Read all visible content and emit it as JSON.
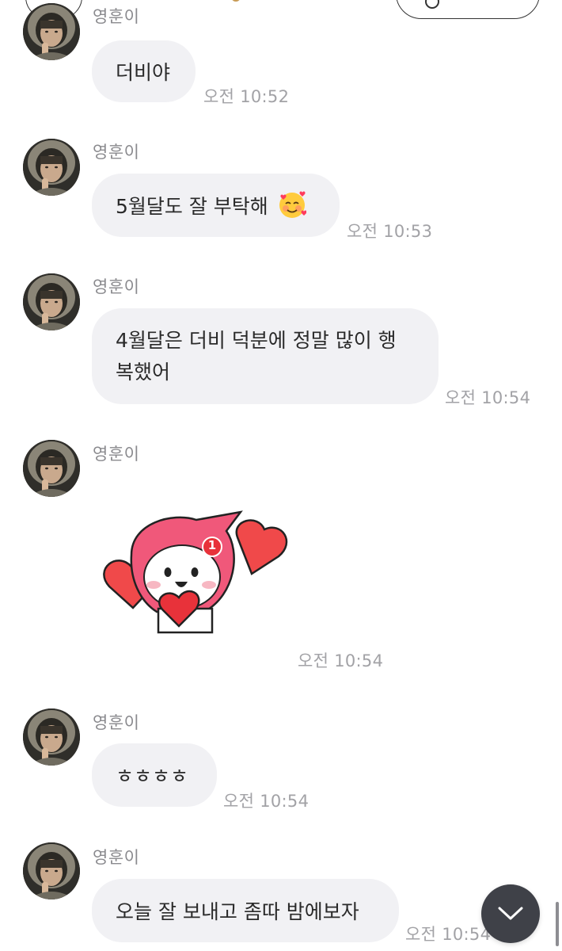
{
  "sender_name": "영훈이",
  "messages": [
    {
      "type": "text",
      "text": "더비야",
      "time": "오전 10:52"
    },
    {
      "type": "text",
      "text": "5월달도 잘 부탁해",
      "emoji": "smiling-face-with-hearts",
      "time": "오전 10:53"
    },
    {
      "type": "text",
      "lines": [
        "4월달은 더비 덕분에 정말 많이 행",
        "복했어"
      ],
      "time": "오전 10:54"
    },
    {
      "type": "sticker",
      "sticker": "pink-hood-character-holding-heart",
      "badge": "1",
      "time": "오전 10:54"
    },
    {
      "type": "text",
      "text": "ㅎㅎㅎㅎ",
      "time": "오전 10:54"
    },
    {
      "type": "text",
      "text": "오늘 잘 보내고 좀따 밤에보자",
      "time": "오전 10:54"
    }
  ],
  "icons": {
    "scroll_down": "chevron-down-icon",
    "search": "search-icon"
  },
  "colors": {
    "bubble_bg": "#f1f1f4",
    "name_text": "#8a8a8e",
    "time_text": "#a2a2a6",
    "scroll_button": "#3f4148",
    "sticker_red": "#f0494a",
    "sticker_pink": "#f0587a"
  }
}
